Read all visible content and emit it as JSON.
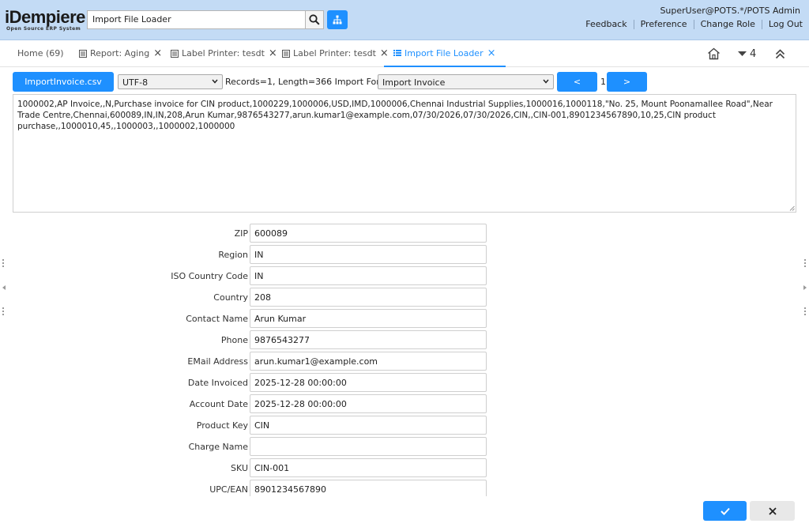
{
  "header": {
    "logo_text": "iDempiere",
    "logo_subtext": "Open Source ERP System",
    "search_value": "Import File Loader",
    "user": "SuperUser@POTS.*/POTS Admin",
    "links": [
      "Feedback",
      "Preference",
      "Change Role",
      "Log Out"
    ]
  },
  "tabs": [
    {
      "label": "Home (69)",
      "closable": false
    },
    {
      "label": "Report: Aging",
      "closable": true
    },
    {
      "label": "Label Printer: tesdt",
      "closable": true
    },
    {
      "label": "Label Printer: tesdt",
      "closable": true
    },
    {
      "label": "Import File Loader",
      "closable": true,
      "active": true
    }
  ],
  "tab_tools": {
    "count": "4"
  },
  "toolbar": {
    "file_button": "ImportInvoice.csv",
    "charset": "UTF-8",
    "records_info": "Records=1, Length=366 Import Format",
    "import_format": "Import Invoice",
    "prev_label": "<",
    "page": "1",
    "next_label": ">"
  },
  "file_content": "1000002,AP Invoice,,N,Purchase invoice for CIN product,1000229,1000006,USD,IMD,1000006,Chennai Industrial Supplies,1000016,1000118,\"No. 25, Mount Poonamallee Road\",Near Trade Centre,Chennai,600089,IN,IN,208,Arun Kumar,9876543277,arun.kumar1@example.com,07/30/2026,07/30/2026,CIN,,CIN-001,8901234567890,10,25,CIN product purchase,,1000010,45,,1000003,,1000002,1000000",
  "fields": [
    {
      "label": "ZIP",
      "value": "600089"
    },
    {
      "label": "Region",
      "value": "IN"
    },
    {
      "label": "ISO Country Code",
      "value": "IN"
    },
    {
      "label": "Country",
      "value": "208"
    },
    {
      "label": "Contact Name",
      "value": "Arun Kumar"
    },
    {
      "label": "Phone",
      "value": "9876543277"
    },
    {
      "label": "EMail Address",
      "value": "arun.kumar1@example.com"
    },
    {
      "label": "Date Invoiced",
      "value": "2025-12-28 00:00:00"
    },
    {
      "label": "Account Date",
      "value": "2025-12-28 00:00:00"
    },
    {
      "label": "Product Key",
      "value": "CIN"
    },
    {
      "label": "Charge Name",
      "value": ""
    },
    {
      "label": "SKU",
      "value": "CIN-001"
    },
    {
      "label": "UPC/EAN",
      "value": "8901234567890"
    }
  ],
  "colors": {
    "accent": "#1e90ff",
    "header_bg": "#c3dbf5"
  }
}
